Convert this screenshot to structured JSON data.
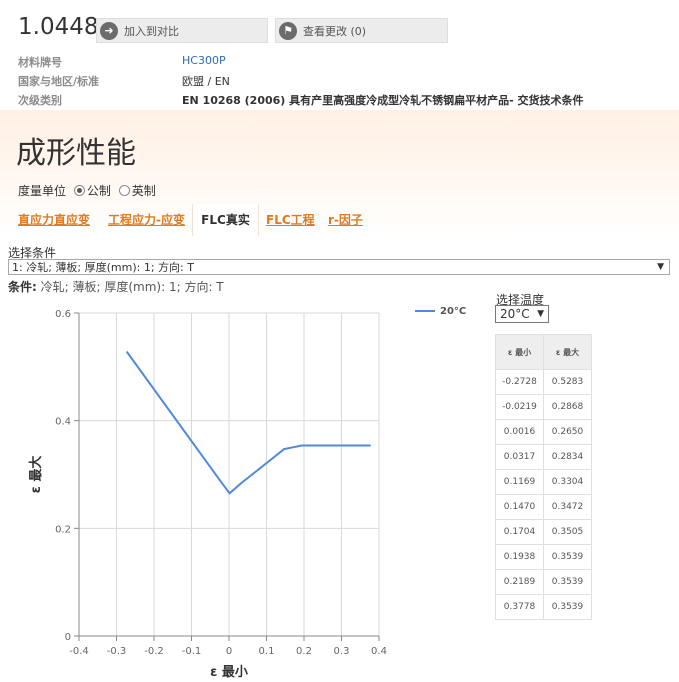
{
  "header": {
    "material_code": "1.0448",
    "compare_button": "加入到对比",
    "changes_button": "查看更改 (0)",
    "meta": [
      {
        "key": "材料牌号",
        "value": "HC300P",
        "style": "link"
      },
      {
        "key": "国家与地区/标准",
        "value": "欧盟 / EN",
        "style": "plain"
      },
      {
        "key": "次级类别",
        "value": "EN 10268 (2006) 具有产里高强度冷成型冷轧不锈钢扁平材产品- 交货技术条件",
        "style": "bold"
      }
    ]
  },
  "section_title": "成形性能",
  "units": {
    "label": "度量单位",
    "metric": "公制",
    "imperial": "英制"
  },
  "tabs": [
    {
      "label": "直应力直应变",
      "active": false
    },
    {
      "label": "工程应力-应变",
      "active": false
    },
    {
      "label": "FLC真实",
      "active": true
    },
    {
      "label": "FLC工程",
      "active": false
    },
    {
      "label": "r-因子",
      "active": false
    }
  ],
  "condition_select": {
    "label": "选择条件",
    "value": "1: 冷轧; 薄板; 厚度(mm): 1; 方向: T"
  },
  "condition_text": {
    "label": "条件:",
    "value": "冷轧; 薄板; 厚度(mm): 1; 方向: T"
  },
  "temperature": {
    "label": "选择温度",
    "value": "20°C"
  },
  "table": {
    "headers": [
      "ε 最小",
      "ε 最大"
    ],
    "rows": [
      [
        "-0.2728",
        "0.5283"
      ],
      [
        "-0.0219",
        "0.2868"
      ],
      [
        "0.0016",
        "0.2650"
      ],
      [
        "0.0317",
        "0.2834"
      ],
      [
        "0.1169",
        "0.3304"
      ],
      [
        "0.1470",
        "0.3472"
      ],
      [
        "0.1704",
        "0.3505"
      ],
      [
        "0.1938",
        "0.3539"
      ],
      [
        "0.2189",
        "0.3539"
      ],
      [
        "0.3778",
        "0.3539"
      ]
    ]
  },
  "colors": {
    "series": "#4e89dd",
    "accent": "#e07a1f",
    "link": "#2a6db5"
  },
  "chart_data": {
    "type": "line",
    "xlabel": "ε 最小",
    "ylabel": "ε 最大",
    "xlim": [
      -0.4,
      0.4
    ],
    "ylim": [
      0,
      0.6
    ],
    "xticks": [
      "-0.4",
      "-0.3",
      "-0.2",
      "-0.1",
      "0",
      "0.1",
      "0.2",
      "0.3",
      "0.4"
    ],
    "yticks": [
      "0",
      "0.2",
      "0.4",
      "0.6"
    ],
    "grid": true,
    "legend": "top-right",
    "series": [
      {
        "name": "20°C",
        "x": [
          -0.2728,
          -0.0219,
          0.0016,
          0.0317,
          0.1169,
          0.147,
          0.1704,
          0.1938,
          0.2189,
          0.3778
        ],
        "y": [
          0.5283,
          0.2868,
          0.265,
          0.2834,
          0.3304,
          0.3472,
          0.3505,
          0.3539,
          0.3539,
          0.3539
        ]
      }
    ]
  }
}
